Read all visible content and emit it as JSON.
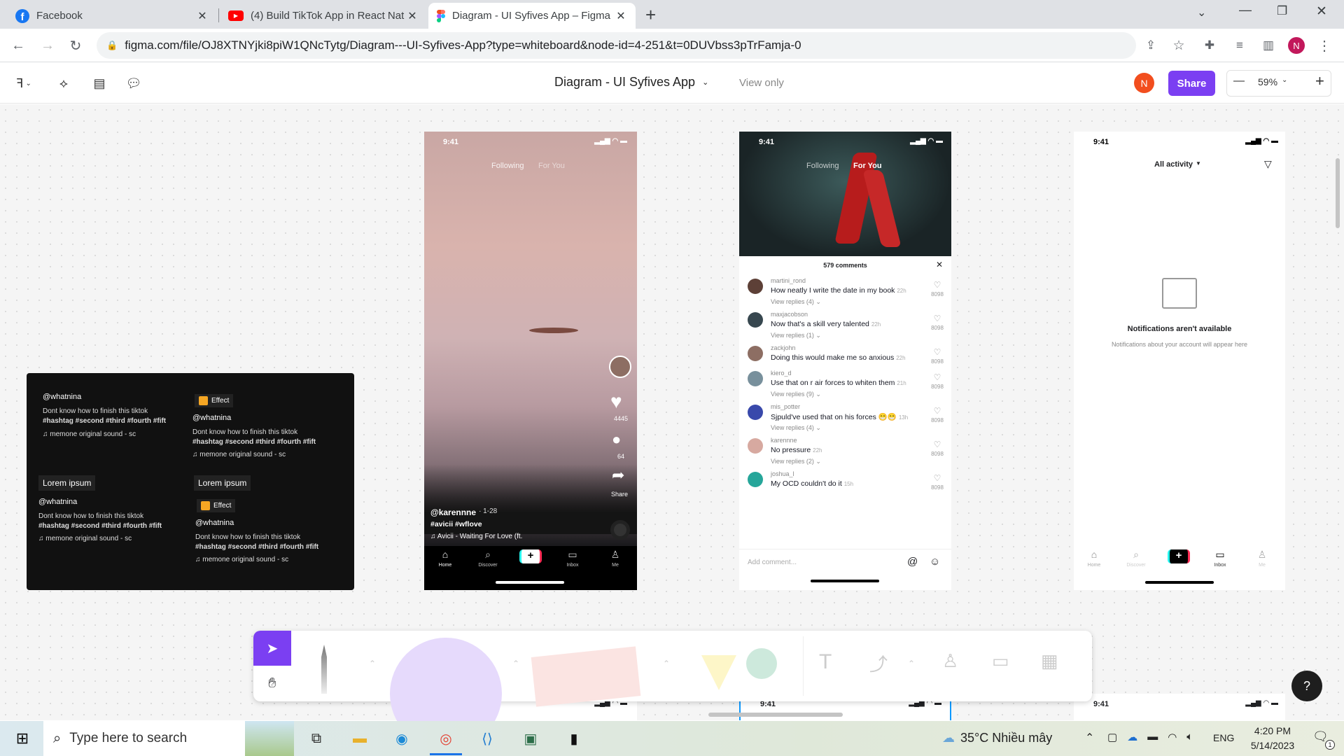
{
  "browser": {
    "tabs": [
      {
        "title": "Facebook",
        "icon": "facebook-icon",
        "active": false
      },
      {
        "title": "(4) Build TikTok App in React Nat",
        "icon": "youtube-icon",
        "active": false
      },
      {
        "title": "Diagram - UI Syfives App – Figma",
        "icon": "figma-icon",
        "active": true
      }
    ],
    "url": "figma.com/file/OJ8XTNYjki8piW1QNcTytg/Diagram---UI-Syfives-App?type=whiteboard&node-id=4-251&t=0DUVbss3pTrFamja-0",
    "profile_initial": "N"
  },
  "figma": {
    "file_title": "Diagram - UI Syfives App",
    "mode": "View only",
    "user_initial": "N",
    "share_label": "Share",
    "zoom": "59%",
    "zoom_out": "—",
    "zoom_in": "+",
    "help": "?"
  },
  "dark_card": {
    "handle1": "@whatnina",
    "caption": "Dont know how to finish this tiktok",
    "tags": "#hashtag #second #third #fourth #fift",
    "sound": "memone   original sound - sc",
    "effect": "Effect",
    "handle2": "@whatnina",
    "lorem": "Lorem ipsum",
    "handle3": "@whatnina",
    "handle4": "@whatnina"
  },
  "phone1": {
    "time": "9:41",
    "following": "Following",
    "for_you": "For You",
    "likes": "4445",
    "comments": "64",
    "share": "Share",
    "user": "@karennne",
    "date": "· 1-28",
    "tags": "#avicii #wflove",
    "song": "Avicii - Waiting For Love (ft.",
    "nav": [
      "Home",
      "Discover",
      "",
      "Inbox",
      "Me"
    ]
  },
  "phone2": {
    "time": "9:41",
    "following": "Following",
    "for_you": "For You",
    "comments_title": "579 comments",
    "comments": [
      {
        "user": "martini_rond",
        "text": "How neatly I write the date in my book",
        "age": "22h",
        "replies": "View replies (4)",
        "likes": "8098"
      },
      {
        "user": "maxjacobson",
        "text": "Now that's a skill very talented",
        "age": "22h",
        "replies": "View replies (1)",
        "likes": "8098"
      },
      {
        "user": "zackjohn",
        "text": "Doing this would make me so anxious",
        "age": "22h",
        "replies": "",
        "likes": "8098"
      },
      {
        "user": "kiero_d",
        "text": "Use that on r air forces to whiten them",
        "age": "21h",
        "replies": "View replies (9)",
        "likes": "8098"
      },
      {
        "user": "mis_potter",
        "text": "Sjpuld've used that on his forces 😁😁",
        "age": "13h",
        "replies": "View replies (4)",
        "likes": "8098"
      },
      {
        "user": "karennne",
        "text": "No pressure",
        "age": "22h",
        "replies": "View replies (2)",
        "likes": "8098"
      },
      {
        "user": "joshua_l",
        "text": "My OCD couldn't do it",
        "age": "15h",
        "replies": "",
        "likes": "8098"
      }
    ],
    "add_comment": "Add comment..."
  },
  "phone3": {
    "time": "9:41",
    "dropdown": "All activity",
    "empty_title": "Notifications aren't available",
    "empty_sub": "Notifications about your account will appear here",
    "nav": [
      "Home",
      "Discover",
      "",
      "Inbox",
      "Me"
    ]
  },
  "bottom_frames": {
    "time": "9:41"
  },
  "taskbar": {
    "search_placeholder": "Type here to search",
    "weather": "35°C  Nhiều mây",
    "lang": "ENG",
    "time": "4:20 PM",
    "date": "5/14/2023",
    "notif": "1"
  },
  "colors": {
    "figma_purple": "#7b3ff2",
    "avatar_red": "#f24e1e",
    "tiktok_pink": "#fe2c55"
  }
}
